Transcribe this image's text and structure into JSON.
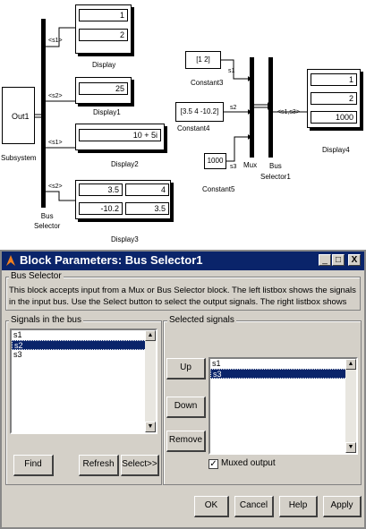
{
  "diagram": {
    "subsystem": {
      "port": "Out1",
      "label": "Subsystem"
    },
    "bus_selector_left": {
      "label": "Bus\nSelector",
      "signals": [
        "<s1>",
        "<s2>",
        "<s1>",
        "<s2>"
      ]
    },
    "display": {
      "label": "Display",
      "values": [
        "1",
        "2"
      ]
    },
    "display1": {
      "label": "Display1",
      "values": [
        "25"
      ]
    },
    "display2": {
      "label": "Display2",
      "values": [
        "10 + 5i"
      ]
    },
    "display3": {
      "label": "Display3",
      "values": [
        "3.5",
        "4",
        "-10.2",
        "3.5"
      ]
    },
    "constant3": {
      "label": "Constant3",
      "value": "[1 2]",
      "signal": "s1"
    },
    "constant4": {
      "label": "Constant4",
      "value": "[3.5 4 -10.2]",
      "signal": "s2"
    },
    "constant5": {
      "label": "Constant5",
      "value": "1000",
      "signal": "s3"
    },
    "mux": {
      "label": "Mux"
    },
    "bus_selector1": {
      "label": "Bus\nSelector1",
      "signal": "<s1,s3>"
    },
    "display4": {
      "label": "Display4",
      "values": [
        "1",
        "2",
        "1000"
      ]
    }
  },
  "dialog": {
    "title": "Block Parameters: Bus Selector1",
    "window_buttons": [
      "_",
      "□",
      "X"
    ],
    "group_label": "Bus Selector",
    "description": "This block accepts input from a Mux or Bus Selector block. The left listbox shows the signals in the input bus. Use the Select button to select the output signals. The right listbox shows the selections. Use the Up, Down, or Remove buttons to reorder the selections. Check 'Muxed output' to multiplex the output.",
    "signals_group": "Signals in the bus",
    "signals": [
      "s1",
      "s2",
      "s3"
    ],
    "signals_selected_index": 1,
    "find_label": "Find",
    "refresh_label": "Refresh",
    "select_label": "Select>>",
    "selected_group": "Selected signals",
    "selected": [
      "s1",
      "s3"
    ],
    "selected_selected_index": 1,
    "up_label": "Up",
    "down_label": "Down",
    "remove_label": "Remove",
    "muxed_label": "Muxed output",
    "muxed_checked": true,
    "ok_label": "OK",
    "cancel_label": "Cancel",
    "help_label": "Help",
    "apply_label": "Apply"
  }
}
